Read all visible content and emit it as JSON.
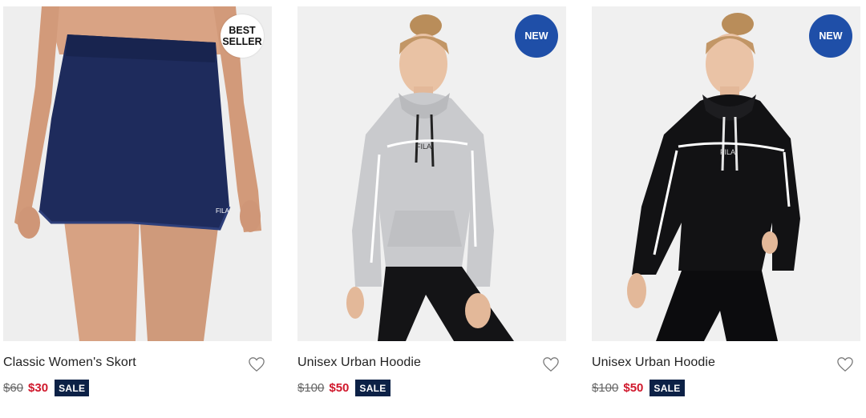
{
  "products": [
    {
      "badge": "BEST SELLER",
      "badge_line1": "BEST",
      "badge_line2": "SELLER",
      "title": "Classic Women's Skort",
      "old_price": "$60",
      "sale_price": "$30",
      "sale_tag": "SALE",
      "image": "navy skort worn by model"
    },
    {
      "badge": "NEW",
      "title": "Unisex Urban Hoodie",
      "old_price": "$100",
      "sale_price": "$50",
      "sale_tag": "SALE",
      "image": "grey hoodie worn by model"
    },
    {
      "badge": "NEW",
      "title": "Unisex Urban Hoodie",
      "old_price": "$100",
      "sale_price": "$50",
      "sale_tag": "SALE",
      "image": "black hoodie worn by model"
    }
  ],
  "colors": {
    "new_badge": "#1f4fa8",
    "sale_price": "#d0182c",
    "sale_tag": "#0c2146",
    "image_bg": "#efefef"
  },
  "icons": [
    "heart-icon"
  ]
}
